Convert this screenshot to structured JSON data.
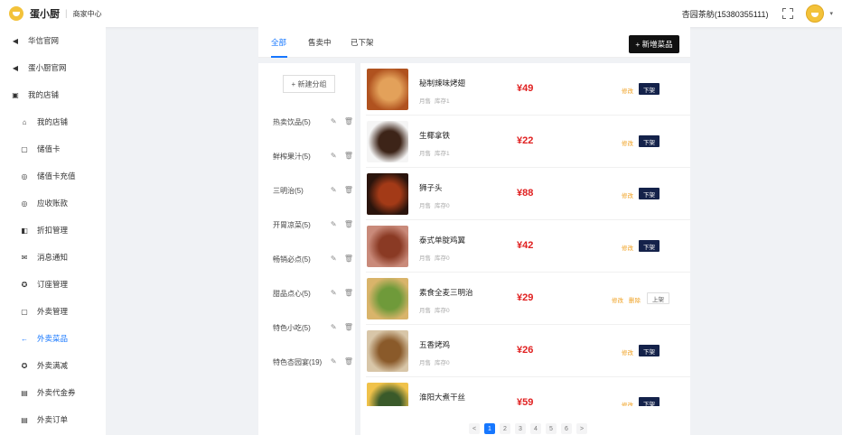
{
  "header": {
    "brand": "蛋小厨",
    "separator": "|",
    "merchant_center": "商家中心",
    "username": "杏园茶舫(15380355111)",
    "caret": "▾"
  },
  "sidebar": {
    "items": [
      {
        "label": "华信官网",
        "icon": "◀",
        "icon_name": "send-icon",
        "sub": false,
        "active": false
      },
      {
        "label": "蛋小厨官网",
        "icon": "◀",
        "icon_name": "send-icon",
        "sub": false,
        "active": false
      },
      {
        "label": "我的店铺",
        "icon": "▣",
        "icon_name": "shop-icon",
        "sub": false,
        "active": false
      },
      {
        "label": "我的店铺",
        "icon": "⌂",
        "icon_name": "home-icon",
        "sub": true,
        "active": false
      },
      {
        "label": "储值卡",
        "icon": "▢",
        "icon_name": "card-icon",
        "sub": true,
        "active": false
      },
      {
        "label": "储值卡充值",
        "icon": "◎",
        "icon_name": "recharge-icon",
        "sub": true,
        "active": false
      },
      {
        "label": "应收账款",
        "icon": "◎",
        "icon_name": "account-icon",
        "sub": true,
        "active": false
      },
      {
        "label": "折扣管理",
        "icon": "◧",
        "icon_name": "discount-icon",
        "sub": true,
        "active": false
      },
      {
        "label": "消息通知",
        "icon": "✉",
        "icon_name": "mail-icon",
        "sub": true,
        "active": false
      },
      {
        "label": "订座管理",
        "icon": "✪",
        "icon_name": "seat-icon",
        "sub": true,
        "active": false
      },
      {
        "label": "外卖管理",
        "icon": "▢",
        "icon_name": "takeout-icon",
        "sub": true,
        "active": false
      },
      {
        "label": "外卖菜品",
        "icon": "←",
        "icon_name": "arrow-left-icon",
        "sub": true,
        "active": true
      },
      {
        "label": "外卖满减",
        "icon": "✪",
        "icon_name": "full-reduction-icon",
        "sub": true,
        "active": false
      },
      {
        "label": "外卖代金券",
        "icon": "▤",
        "icon_name": "voucher-icon",
        "sub": true,
        "active": false
      },
      {
        "label": "外卖订单",
        "icon": "▤",
        "icon_name": "order-icon",
        "sub": true,
        "active": false
      }
    ]
  },
  "tabs": [
    {
      "label": "全部",
      "active": true
    },
    {
      "label": "售卖中",
      "active": false
    },
    {
      "label": "已下架",
      "active": false
    }
  ],
  "add_dish_label": "+ 新增菜品",
  "new_group_label": "+ 新建分组",
  "category_ops": "✎ 🗑",
  "categories": [
    "热卖饮品(5)",
    "鲜榨果汁(5)",
    "三明治(5)",
    "开胃凉菜(5)",
    "畅销必点(5)",
    "甜品点心(5)",
    "特色小吃(5)",
    "特色杏园宴(19)"
  ],
  "dishes": [
    {
      "name": "秘制辣味烤翅",
      "monthly": "月售",
      "stock": "库存1",
      "price": "¥49",
      "edit": "修改",
      "delete": "",
      "status": "下架",
      "dark": true,
      "colors": [
        "#b0521f",
        "#e3a15a"
      ]
    },
    {
      "name": "生椰拿铁",
      "monthly": "月售",
      "stock": "库存1",
      "price": "¥22",
      "edit": "修改",
      "delete": "",
      "status": "下架",
      "dark": true,
      "colors": [
        "#f5f5f5",
        "#3d2418"
      ]
    },
    {
      "name": "狮子头",
      "monthly": "月售",
      "stock": "库存0",
      "price": "¥88",
      "edit": "修改",
      "delete": "",
      "status": "下架",
      "dark": true,
      "colors": [
        "#2a140c",
        "#a33a17"
      ]
    },
    {
      "name": "泰式单腚鸡翼",
      "monthly": "月售",
      "stock": "库存0",
      "price": "¥42",
      "edit": "修改",
      "delete": "",
      "status": "下架",
      "dark": true,
      "colors": [
        "#c98a7a",
        "#8a3a24"
      ]
    },
    {
      "name": "素食全麦三明治",
      "monthly": "月售",
      "stock": "库存0",
      "price": "¥29",
      "edit": "修改",
      "delete": "删除",
      "status": "上架",
      "dark": false,
      "colors": [
        "#d9b46a",
        "#6f9a3a"
      ]
    },
    {
      "name": "五香烤鸡",
      "monthly": "月售",
      "stock": "库存0",
      "price": "¥26",
      "edit": "修改",
      "delete": "",
      "status": "下架",
      "dark": true,
      "colors": [
        "#d8c6a8",
        "#8a5a2a"
      ]
    },
    {
      "name": "淮阳大煮干丝",
      "monthly": "",
      "stock": "",
      "price": "¥59",
      "edit": "修改",
      "delete": "",
      "status": "下架",
      "dark": true,
      "colors": [
        "#f0c24a",
        "#3a5a2a"
      ]
    }
  ],
  "pagination": [
    "<",
    "1",
    "2",
    "3",
    "4",
    "5",
    "6",
    ">"
  ],
  "pagination_active": "1"
}
